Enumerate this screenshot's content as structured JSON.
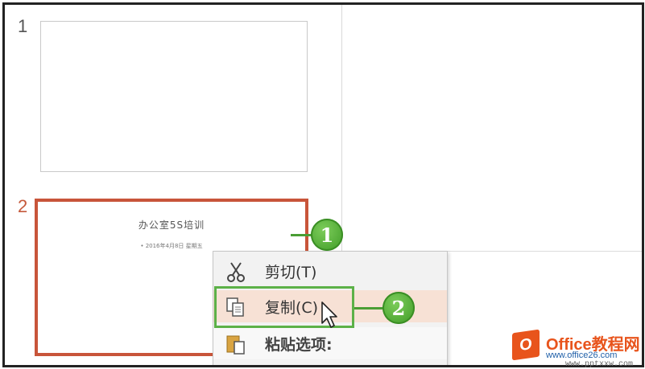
{
  "slides": [
    {
      "number": "1"
    },
    {
      "number": "2",
      "title": "办公室5S培训",
      "subtitle": "• 2016年4月8日 星期五"
    }
  ],
  "context_menu": {
    "cut_label": "剪切(T)",
    "copy_label": "复制(C)",
    "paste_header": "粘贴选项:"
  },
  "callouts": {
    "step1": "1",
    "step2": "2"
  },
  "watermark": {
    "logo_letter": "O",
    "brand": "Office教程网",
    "url": "www.office26.com",
    "url2": "www.pptxxw.com"
  },
  "colors": {
    "selection": "#c8553a",
    "callout_green": "#4a9e34",
    "watermark_orange": "#e8541c"
  }
}
